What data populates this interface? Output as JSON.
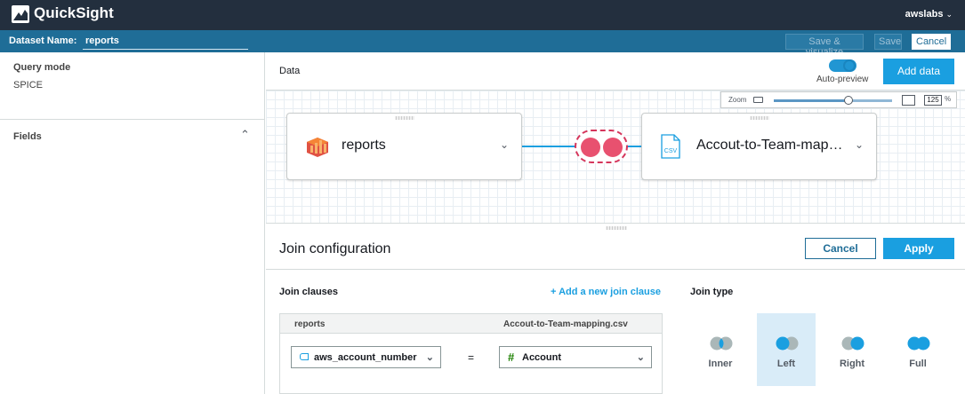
{
  "app": {
    "title": "QuickSight",
    "user": "awslabs"
  },
  "dataset_bar": {
    "label": "Dataset Name:",
    "name": "reports",
    "save_visualize": "Save & visualize",
    "save": "Save",
    "cancel": "Cancel"
  },
  "left_panel": {
    "query_mode_label": "Query mode",
    "query_mode_value": "SPICE",
    "fields_label": "Fields"
  },
  "data_panel": {
    "title": "Data",
    "auto_preview_label": "Auto-preview",
    "auto_preview_on": true,
    "add_data": "Add data",
    "zoom_label": "Zoom",
    "zoom_percent": "125",
    "zoom_unit": "%",
    "zoom_level": 0.63
  },
  "nodes": [
    {
      "name": "reports",
      "icon": "amazon-s3-icon"
    },
    {
      "name": "Accout-to-Team-mapping.csv",
      "icon": "csv-file-icon"
    }
  ],
  "join_config": {
    "title": "Join configuration",
    "cancel": "Cancel",
    "apply": "Apply",
    "clauses_label": "Join clauses",
    "add_clause": "+ Add a new join clause",
    "join_type_label": "Join type",
    "left_table": "reports",
    "right_table": "Accout-to-Team-mapping.csv",
    "left_field": "aws_account_number",
    "operator": "=",
    "right_field": "Account",
    "right_field_type_icon": "#",
    "join_types": [
      {
        "label": "Inner",
        "selected": false
      },
      {
        "label": "Left",
        "selected": true
      },
      {
        "label": "Right",
        "selected": false
      },
      {
        "label": "Full",
        "selected": false
      }
    ]
  },
  "colors": {
    "topbar": "#232f3e",
    "dataset_bar": "#1f6d97",
    "accent": "#1a9fe0",
    "join_pink": "#e8516f"
  }
}
